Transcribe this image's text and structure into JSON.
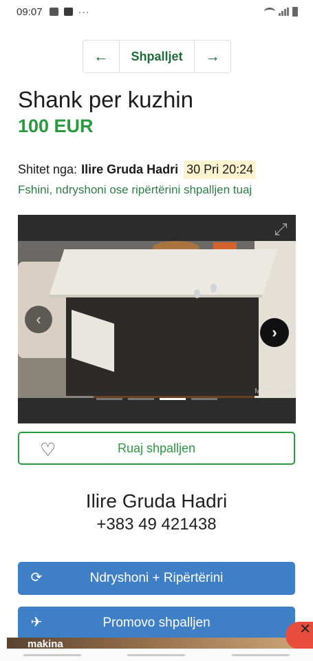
{
  "status_bar": {
    "time": "09:07",
    "dots": "···"
  },
  "pager": {
    "prev": "←",
    "label": "Shpalljet",
    "next": "→"
  },
  "listing": {
    "title": "Shank per kuzhin",
    "price": "100 EUR",
    "seller_prefix": "Shitet nga:",
    "seller_name": "Ilire Gruda Hadri",
    "date": "30 Pri 20:24",
    "edit_link": "Fshini, ndryshoni ose ripërtërini shpalljen tuaj"
  },
  "gallery": {
    "watermark": "Merrjep.com",
    "image_count": 4,
    "active_index": 2,
    "icons": [
      "expand-icon",
      "chevron-left-icon",
      "chevron-right-icon"
    ]
  },
  "actions": {
    "save_label": "Ruaj shpalljen",
    "renew_label": "Ndryshoni + Ripërtërini",
    "promote_label": "Promovo shpalljen"
  },
  "contact": {
    "name": "Ilire Gruda Hadri",
    "phone": "+383 49 421438"
  },
  "ad": {
    "text": "makina"
  },
  "colors": {
    "green": "#2a9a3e",
    "dark_green": "#1e6b3a",
    "blue": "#3f7fc6",
    "date_highlight": "#fdf4cf"
  }
}
